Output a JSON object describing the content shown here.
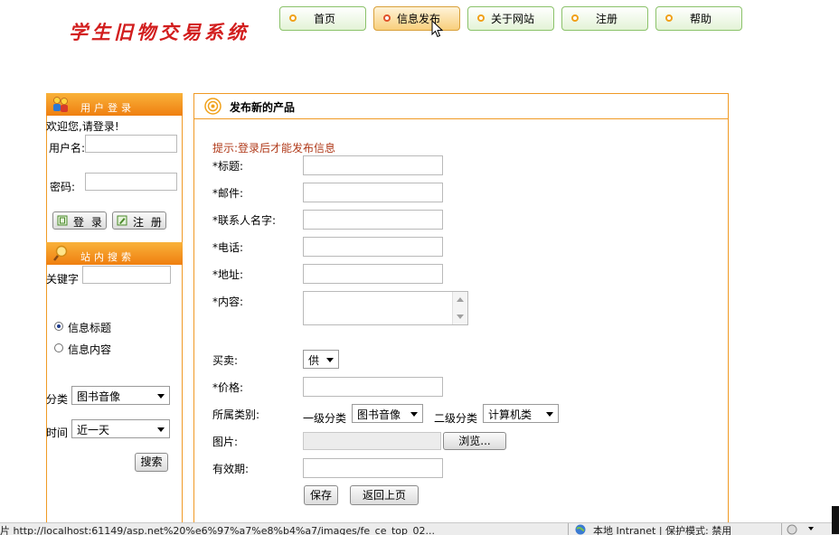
{
  "logo": {
    "text": "学生旧物交易系统"
  },
  "nav": {
    "items": [
      {
        "label": "首页"
      },
      {
        "label": "信息发布"
      },
      {
        "label": "关于网站"
      },
      {
        "label": "注册"
      },
      {
        "label": "帮助"
      }
    ]
  },
  "login": {
    "title": "用户登录",
    "welcome": "欢迎您,请登录!",
    "username_label": "用户名:",
    "password_label": "密码:",
    "login_button": "登 录",
    "register_button": "注 册"
  },
  "search": {
    "title": "站内搜索",
    "keyword_label": "关键字",
    "radio_title": "信息标题",
    "radio_content": "信息内容",
    "category_label": "分类",
    "category_value": "图书音像",
    "time_label": "时间",
    "time_value": "近一天",
    "search_button": "搜索"
  },
  "main": {
    "title": "发布新的产品",
    "hint": "提示:登录后才能发布信息",
    "labels": {
      "title": "*标题:",
      "email": "*邮件:",
      "contact": "*联系人名字:",
      "phone": "*电话:",
      "address": "*地址:",
      "content": "*内容:",
      "trade": "买卖:",
      "price": "*价格:",
      "category": "所属类别:",
      "image": "图片:",
      "validity": "有效期:"
    },
    "trade_value": "供",
    "level1_label": "一级分类",
    "level1_value": "图书音像",
    "level2_label": "二级分类",
    "level2_value": "计算机类",
    "browse_button": "浏览...",
    "save_button": "保存",
    "back_button": "返回上页"
  },
  "statusbar": {
    "url": "片 http://localhost:61149/asp.net%20%e6%97%a7%e8%b4%a7/images/fe_ce_top_02...",
    "zone": "本地 Intranet | 保护模式: 禁用"
  },
  "colors": {
    "accent": "#f09a25",
    "hint": "#b03a1a",
    "logo": "#d21e1e"
  }
}
